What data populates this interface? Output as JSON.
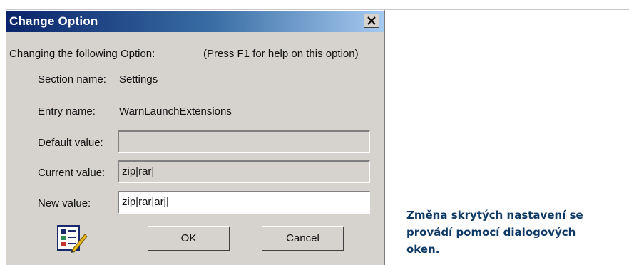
{
  "dialog": {
    "title": "Change Option",
    "intro": "Changing the following Option:",
    "help_hint": "(Press F1 for help on this option)",
    "section_label": "Section name:",
    "section_value": "Settings",
    "entry_label": "Entry name:",
    "entry_value": "WarnLaunchExtensions",
    "default_label": "Default value:",
    "default_value": "",
    "current_label": "Current value:",
    "current_value": "zip|rar|",
    "new_label": "New value:",
    "new_value": "zip|rar|arj|",
    "ok_label": "OK",
    "cancel_label": "Cancel",
    "close_icon": "close-icon",
    "app_icon": "settings-editor-icon"
  },
  "caption": {
    "line1": "Změna skrytých nastavení se",
    "line2": "provádí pomocí dialogových",
    "line3": "oken."
  },
  "colors": {
    "titlebar_start": "#0a246a",
    "titlebar_end": "#a6caf0",
    "dialog_face": "#d6d3ce",
    "caption_text": "#0f3a66"
  }
}
